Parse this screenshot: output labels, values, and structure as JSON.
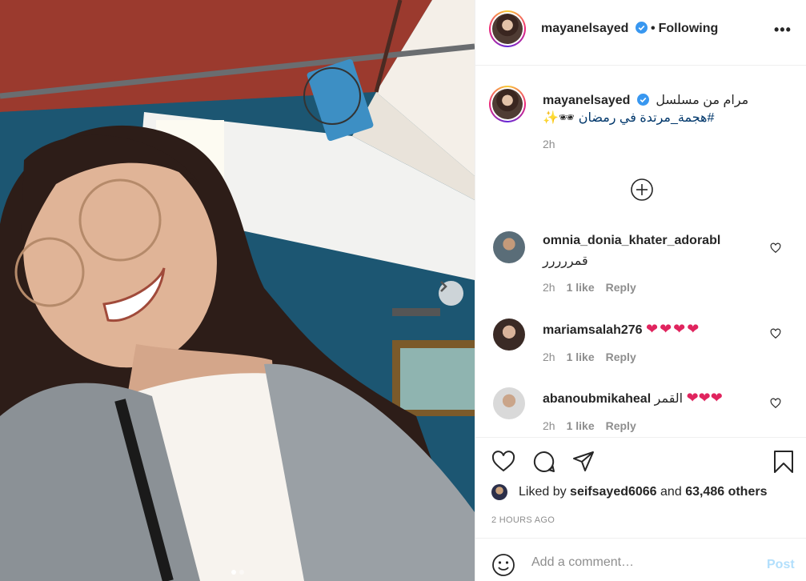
{
  "post": {
    "username": "mayanelsayed",
    "follow_label": "Following",
    "more_label": "•••",
    "caption_text": "مرام من مسلسل",
    "caption_hashtag": "#هجمة_مرتدة في رمضان",
    "caption_emojis": "🕶✨",
    "caption_time": "2h",
    "liked_by_prefix": "Liked by",
    "liked_by_user": "seifsayed6066",
    "liked_by_mid": "and",
    "liked_by_count": "63,486 others",
    "posted_ago": "2 HOURS AGO",
    "add_comment_placeholder": "Add a comment…",
    "post_label": "Post"
  },
  "comments": [
    {
      "user": "omnia_donia_khater_adorabl",
      "text": "قمررررر",
      "hearts": "",
      "time": "2h",
      "likes": "1 like",
      "reply": "Reply"
    },
    {
      "user": "mariamsalah276",
      "text": "",
      "hearts": "❤❤❤❤",
      "time": "2h",
      "likes": "1 like",
      "reply": "Reply"
    },
    {
      "user": "abanoubmikaheal",
      "text": "القمر",
      "hearts": "❤❤❤",
      "time": "2h",
      "likes": "1 like",
      "reply": "Reply"
    }
  ],
  "icons": {
    "verified": "verified-badge-icon",
    "next": "chevron-right-icon",
    "like": "heart-icon",
    "comment": "comment-bubble-icon",
    "share": "paper-plane-icon",
    "save": "bookmark-icon",
    "add": "plus-circle-icon",
    "emoji": "smiley-icon"
  },
  "colors": {
    "verified": "#3897f0",
    "hearts": "#e0245e",
    "post_disabled": "#b2dffc",
    "muted": "#8e8e8e"
  },
  "carousel": {
    "current": 1,
    "total": 2
  }
}
